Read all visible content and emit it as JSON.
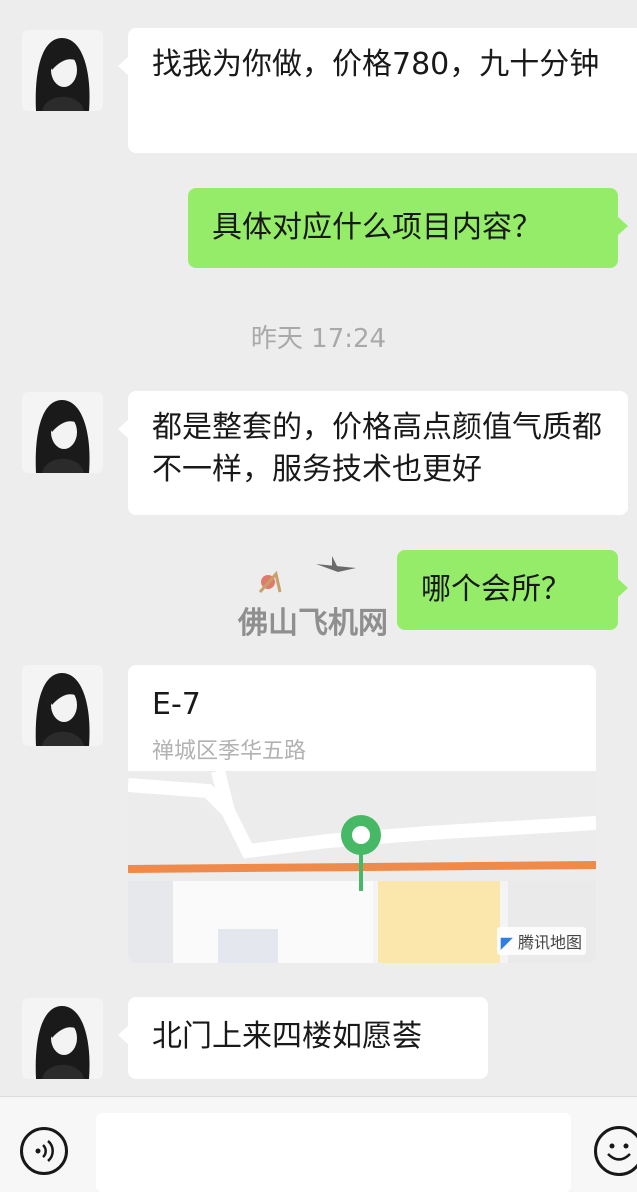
{
  "messages": {
    "m1": "找我为你做，价格780，九十分钟",
    "m2": "具体对应什么项目内容？",
    "timestamp": "昨天 17:24",
    "m3": "都是整套的，价格高点颜值气质都不一样，服务技术也更好",
    "m4": "哪个会所？",
    "location": {
      "title": "E-7",
      "address": "禅城区季华五路",
      "map_provider": "腾讯地图"
    },
    "m5": "北门上来四楼如愿荟"
  },
  "watermark": "佛山飞机网",
  "colors": {
    "background": "#ededed",
    "outgoing_bubble": "#95ec69",
    "incoming_bubble": "#ffffff",
    "map_pin": "#46b866",
    "map_road": "#ef8a4a"
  },
  "icons": {
    "voice": "voice-icon",
    "emoji": "emoji-icon",
    "map_pin": "map-pin-icon"
  }
}
